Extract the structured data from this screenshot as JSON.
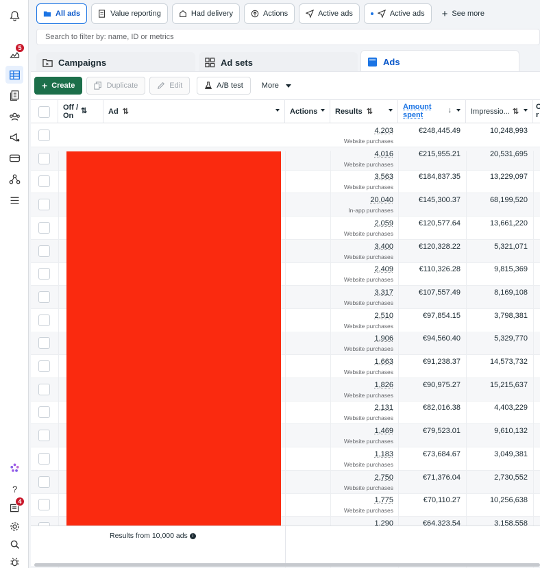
{
  "filters": {
    "chips": [
      {
        "label": "All ads",
        "icon": "folder-icon",
        "selected": true
      },
      {
        "label": "Value reporting",
        "icon": "report-icon"
      },
      {
        "label": "Had delivery",
        "icon": "inbox-icon"
      },
      {
        "label": "Actions",
        "icon": "upload-icon"
      },
      {
        "label": "Active ads",
        "icon": "send-icon"
      },
      {
        "label": "Active ads",
        "icon": "send-icon",
        "dot": true
      }
    ],
    "see_more": "See more",
    "search_placeholder": "Search to filter by: name, ID or metrics"
  },
  "tabs": [
    {
      "label": "Campaigns",
      "icon": "campaign-folder-icon"
    },
    {
      "label": "Ad sets",
      "icon": "grid-icon"
    },
    {
      "label": "Ads",
      "icon": "ads-icon",
      "active": true
    }
  ],
  "toolbar": {
    "create": "Create",
    "duplicate": "Duplicate",
    "edit": "Edit",
    "ab_test": "A/B test",
    "more": "More"
  },
  "columns": {
    "off_on_1": "Off /",
    "off_on_2": "On",
    "ad": "Ad",
    "actions": "Actions",
    "results": "Results",
    "amount_1": "Amount",
    "amount_2": "spent",
    "impressions": "Impressio...",
    "extra_1": "C",
    "extra_2": "r"
  },
  "rows": [
    {
      "results": "4,203",
      "result_type": "Website purchases",
      "amount": "€248,445.49",
      "impressions": "10,248,993"
    },
    {
      "results": "4,016",
      "result_type": "Website purchases",
      "amount": "€215,955.21",
      "impressions": "20,531,695"
    },
    {
      "results": "3,563",
      "result_type": "Website purchases",
      "amount": "€184,837.35",
      "impressions": "13,229,097"
    },
    {
      "results": "20,040",
      "result_type": "In-app purchases",
      "amount": "€145,300.37",
      "impressions": "68,199,520"
    },
    {
      "results": "2,059",
      "result_type": "Website purchases",
      "amount": "€120,577.64",
      "impressions": "13,661,220"
    },
    {
      "results": "3,400",
      "result_type": "Website purchases",
      "amount": "€120,328.22",
      "impressions": "5,321,071"
    },
    {
      "results": "2,409",
      "result_type": "Website purchases",
      "amount": "€110,326.28",
      "impressions": "9,815,369"
    },
    {
      "results": "3,317",
      "result_type": "Website purchases",
      "amount": "€107,557.49",
      "impressions": "8,169,108"
    },
    {
      "results": "2,510",
      "result_type": "Website purchases",
      "amount": "€97,854.15",
      "impressions": "3,798,381"
    },
    {
      "results": "1,906",
      "result_type": "Website purchases",
      "amount": "€94,560.40",
      "impressions": "5,329,770"
    },
    {
      "results": "1,663",
      "result_type": "Website purchases",
      "amount": "€91,238.37",
      "impressions": "14,573,732"
    },
    {
      "results": "1,826",
      "result_type": "Website purchases",
      "amount": "€90,975.27",
      "impressions": "15,215,637"
    },
    {
      "results": "2,131",
      "result_type": "Website purchases",
      "amount": "€82,016.38",
      "impressions": "4,403,229"
    },
    {
      "results": "1,469",
      "result_type": "Website purchases",
      "amount": "€79,523.01",
      "impressions": "9,610,132"
    },
    {
      "results": "1,183",
      "result_type": "Website purchases",
      "amount": "€73,684.67",
      "impressions": "3,049,381"
    },
    {
      "results": "2,750",
      "result_type": "Website purchases",
      "amount": "€71,376.04",
      "impressions": "2,730,552"
    },
    {
      "results": "1,775",
      "result_type": "Website purchases",
      "amount": "€70,110.27",
      "impressions": "10,256,638"
    },
    {
      "results": "1,290",
      "result_type": "",
      "amount": "€64,323.54",
      "impressions": "3,158,558"
    }
  ],
  "footer": {
    "summary": "Results from 10,000 ads"
  },
  "rail": {
    "campaign_badge": "5",
    "help_badge": "4"
  },
  "colors": {
    "accent": "#1b74e4",
    "create_button": "#1c6f4a",
    "redaction": "#fa2a0f",
    "badge": "#c9182b"
  }
}
